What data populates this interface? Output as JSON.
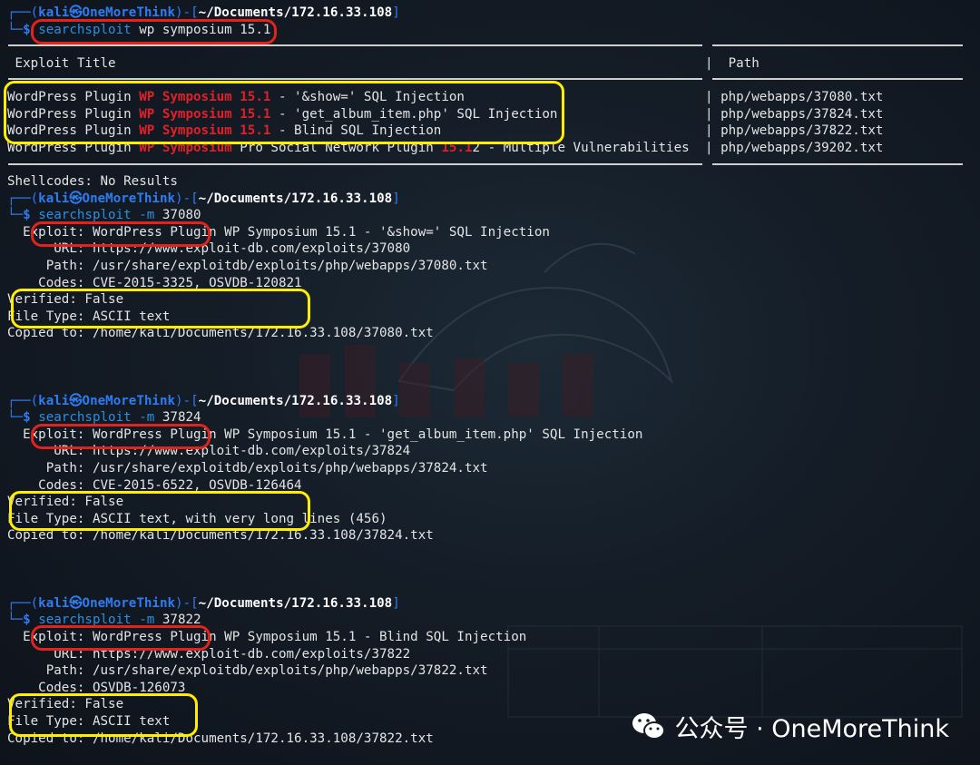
{
  "prompt": {
    "user": "kali",
    "at": "㉿",
    "host": "OneMoreThink",
    "path": "~/Documents/172.16.33.108",
    "open": "┌──(",
    "mid": ")-[",
    "close": "]",
    "corner": "└─",
    "dollar": "$"
  },
  "search": {
    "cmd": "searchsploit",
    "args": " wp symposium 15.1",
    "header_title": "Exploit Title",
    "header_path": "Path",
    "rows": [
      {
        "pre": "WordPress Plugin ",
        "h1": "WP Symposium",
        "mid": " ",
        "h2": "15.1",
        "post": " - '&show=' SQL Injection",
        "path": "php/webapps/37080.txt"
      },
      {
        "pre": "WordPress Plugin ",
        "h1": "WP Symposium",
        "mid": " ",
        "h2": "15.1",
        "post": " - 'get_album_item.php' SQL Injection",
        "path": "php/webapps/37824.txt"
      },
      {
        "pre": "WordPress Plugin ",
        "h1": "WP Symposium",
        "mid": " ",
        "h2": "15.1",
        "post": " - Blind SQL Injection",
        "path": "php/webapps/37822.txt"
      },
      {
        "pre": "WordPress Plugin ",
        "h1": "WP Symposium",
        "mid": " Pro Social Network Plugin ",
        "h2": "15.1",
        "post": "2 - Multiple Vulnerabilities",
        "path": "php/webapps/39202.txt"
      }
    ],
    "shellcodes": "Shellcodes: No Results"
  },
  "mirrors": [
    {
      "cmd": "searchsploit",
      "flag": " -m ",
      "id": "37080",
      "exploit": "  Exploit: WordPress Plugin WP Symposium 15.1 - '&show=' SQL Injection",
      "url": "      URL: https://www.exploit-db.com/exploits/37080",
      "path": "     Path: /usr/share/exploitdb/exploits/php/webapps/37080.txt",
      "codes": "    Codes: CVE-2015-3325, OSVDB-120821",
      "verified": "Verified: False",
      "filetype": "File Type: ASCII text",
      "copied": "Copied to: /home/kali/Documents/172.16.33.108/37080.txt"
    },
    {
      "cmd": "searchsploit",
      "flag": " -m ",
      "id": "37824",
      "exploit": "  Exploit: WordPress Plugin WP Symposium 15.1 - 'get_album_item.php' SQL Injection",
      "url": "      URL: https://www.exploit-db.com/exploits/37824",
      "path": "     Path: /usr/share/exploitdb/exploits/php/webapps/37824.txt",
      "codes": "    Codes: CVE-2015-6522, OSVDB-126464",
      "verified": "Verified: False",
      "filetype": "File Type: ASCII text, with very long lines (456)",
      "copied": "Copied to: /home/kali/Documents/172.16.33.108/37824.txt"
    },
    {
      "cmd": "searchsploit",
      "flag": " -m ",
      "id": "37822",
      "exploit": "  Exploit: WordPress Plugin WP Symposium 15.1 - Blind SQL Injection",
      "url": "      URL: https://www.exploit-db.com/exploits/37822",
      "path": "     Path: /usr/share/exploitdb/exploits/php/webapps/37822.txt",
      "codes": "    Codes: OSVDB-126073",
      "verified": "Verified: False",
      "filetype": "File Type: ASCII text",
      "copied": "Copied to: /home/kali/Documents/172.16.33.108/37822.txt"
    }
  ],
  "watermark": {
    "icon": "wechat-icon",
    "text": "公众号 · OneMoreThink"
  },
  "colors": {
    "prompt_blue": "#2f7bf0",
    "highlight_red": "#e0202a",
    "annotation_red": "#e3221c",
    "annotation_yellow": "#ffee00"
  }
}
